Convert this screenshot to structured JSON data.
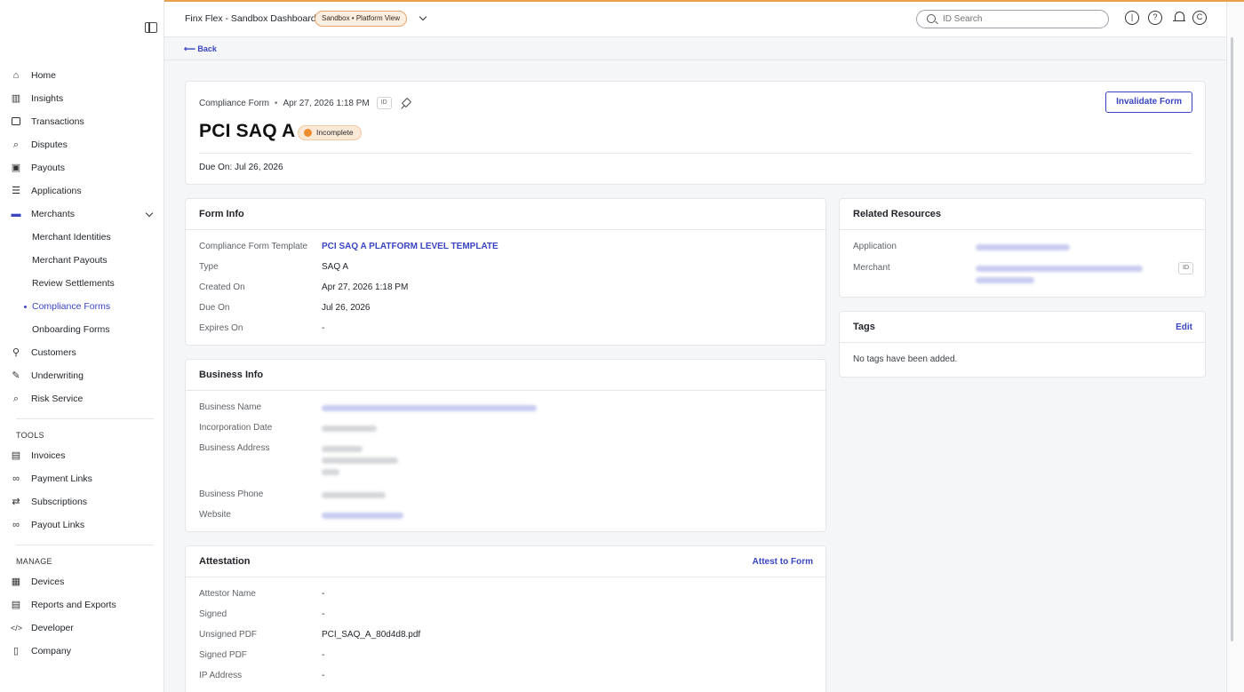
{
  "topbar": {
    "app_title": "Finx Flex - Sandbox Dashboard",
    "env_pill": "Sandbox • Platform View",
    "search_placeholder": "ID Search"
  },
  "sidebar": {
    "items": [
      {
        "label": "Home",
        "icon": "home-icon"
      },
      {
        "label": "Insights",
        "icon": "chart-icon"
      },
      {
        "label": "Transactions",
        "icon": "card-icon"
      },
      {
        "label": "Disputes",
        "icon": "search-icon"
      },
      {
        "label": "Payouts",
        "icon": "cash-icon"
      },
      {
        "label": "Applications",
        "icon": "list-icon"
      },
      {
        "label": "Merchants",
        "icon": "store-icon"
      }
    ],
    "merchant_sub": [
      {
        "label": "Merchant Identities"
      },
      {
        "label": "Merchant Payouts"
      },
      {
        "label": "Review Settlements"
      },
      {
        "label": "Compliance Forms",
        "active": true
      },
      {
        "label": "Onboarding Forms"
      }
    ],
    "items2": [
      {
        "label": "Customers",
        "icon": "person-icon"
      },
      {
        "label": "Underwriting",
        "icon": "underwriting-icon"
      },
      {
        "label": "Risk Service",
        "icon": "risk-icon"
      }
    ],
    "tools_heading": "TOOLS",
    "tools": [
      {
        "label": "Invoices",
        "icon": "invoice-icon"
      },
      {
        "label": "Payment Links",
        "icon": "link-icon"
      },
      {
        "label": "Subscriptions",
        "icon": "repeat-icon"
      },
      {
        "label": "Payout Links",
        "icon": "payout-link-icon"
      }
    ],
    "manage_heading": "MANAGE",
    "manage": [
      {
        "label": "Devices",
        "icon": "device-icon"
      },
      {
        "label": "Reports and Exports",
        "icon": "report-icon"
      },
      {
        "label": "Developer",
        "icon": "code-icon"
      },
      {
        "label": "Company",
        "icon": "building-icon"
      }
    ]
  },
  "back": {
    "label": "Back"
  },
  "header": {
    "type_label": "Compliance Form",
    "timestamp": "Apr 27, 2026 1:18 PM",
    "id_chip": "ID",
    "title": "PCI SAQ A",
    "status": "Incomplete",
    "due": "Due On: Jul 26, 2026",
    "invalidate_label": "Invalidate Form"
  },
  "form_info": {
    "title": "Form Info",
    "rows": [
      {
        "label": "Compliance Form Template",
        "value": "PCI SAQ A PLATFORM LEVEL TEMPLATE"
      },
      {
        "label": "Type",
        "value": "SAQ A"
      },
      {
        "label": "Created On",
        "value": "Apr 27, 2026 1:18 PM"
      },
      {
        "label": "Due On",
        "value": "Jul 26, 2026"
      },
      {
        "label": "Expires On",
        "value": "-"
      }
    ]
  },
  "business_info": {
    "title": "Business Info",
    "labels": [
      "Business Name",
      "Incorporation Date",
      "Business Address",
      "Business Phone",
      "Website"
    ]
  },
  "attestation": {
    "title": "Attestation",
    "action": "Attest to Form",
    "rows": [
      {
        "label": "Attestor Name",
        "value": "-"
      },
      {
        "label": "Signed",
        "value": "-"
      },
      {
        "label": "Unsigned PDF",
        "value": "PCI_SAQ_A_80d4d8.pdf"
      },
      {
        "label": "Signed PDF",
        "value": "-"
      },
      {
        "label": "IP Address",
        "value": "-"
      }
    ]
  },
  "related": {
    "title": "Related Resources",
    "labels": [
      "Application",
      "Merchant"
    ],
    "id_chip": "ID"
  },
  "tags": {
    "title": "Tags",
    "action": "Edit",
    "empty": "No tags have been added."
  },
  "colors": {
    "accent": "#3a45c4",
    "warning": "#ef8c2e",
    "top_line": "#e8a04c"
  }
}
